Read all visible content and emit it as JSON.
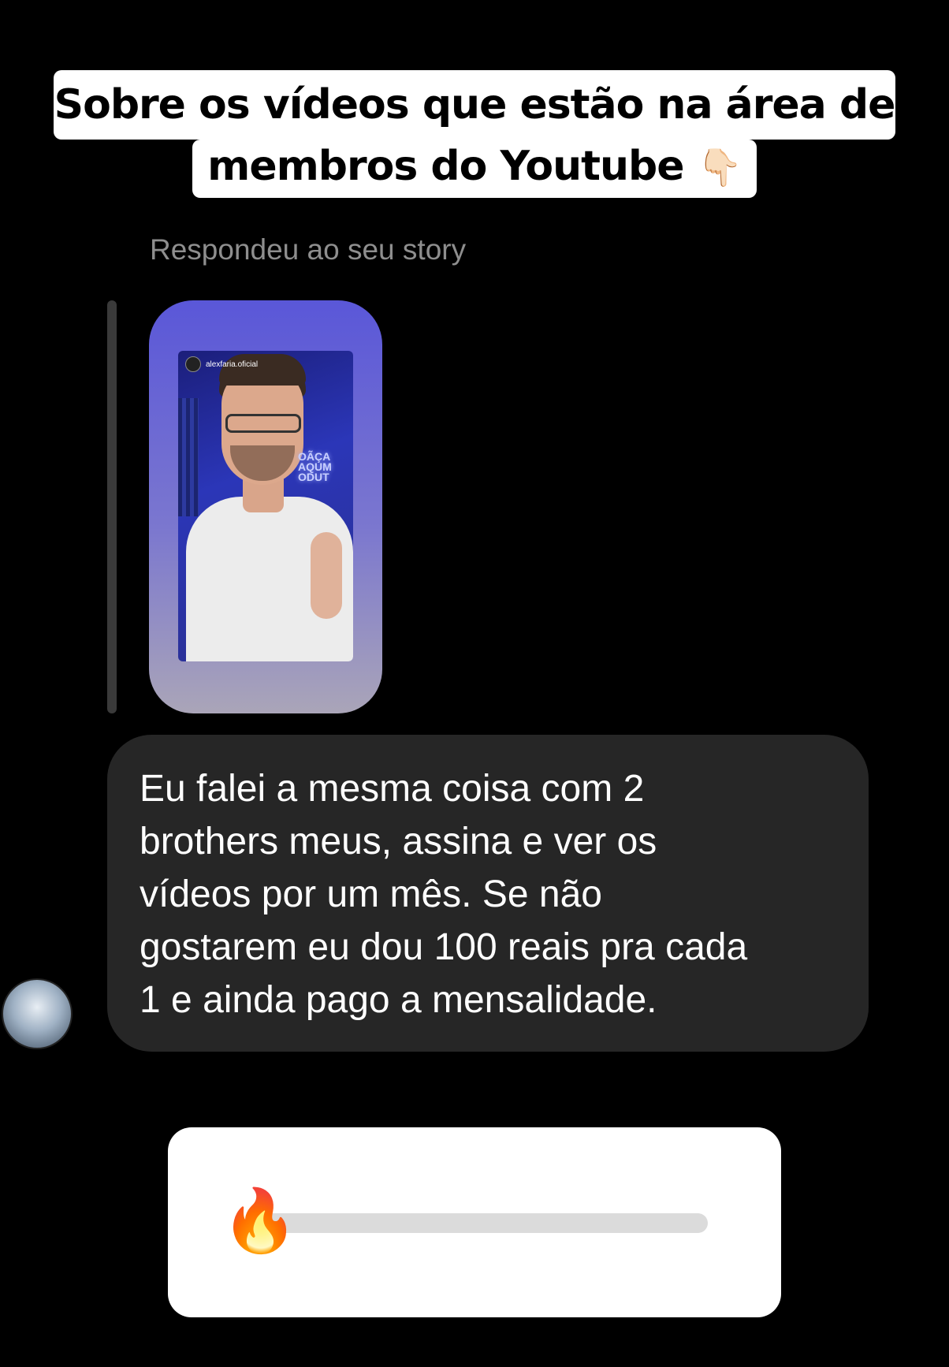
{
  "header_sticker": {
    "line1": "Sobre os vídeos que estão na área de",
    "line2": "membros do Youtube",
    "emoji": "👇🏻"
  },
  "reply_label": "Respondeu ao seu story",
  "story_preview": {
    "username": "alexfaria.oficial",
    "neon_sign": "OÃÇA\nAQUM\nODUT"
  },
  "message": {
    "text": "Eu falei a mesma coisa com 2\nbrothers meus, assina e ver os\nvídeos por um mês. Se não\ngostarem eu dou 100 reais pra cada\n1 e ainda pago a mensalidade."
  },
  "emoji_slider": {
    "emoji": "🔥",
    "value": 0
  },
  "icons": {
    "sender_avatar": "avatar",
    "pointer": "pointing-down-icon",
    "slider": "fire-icon"
  }
}
